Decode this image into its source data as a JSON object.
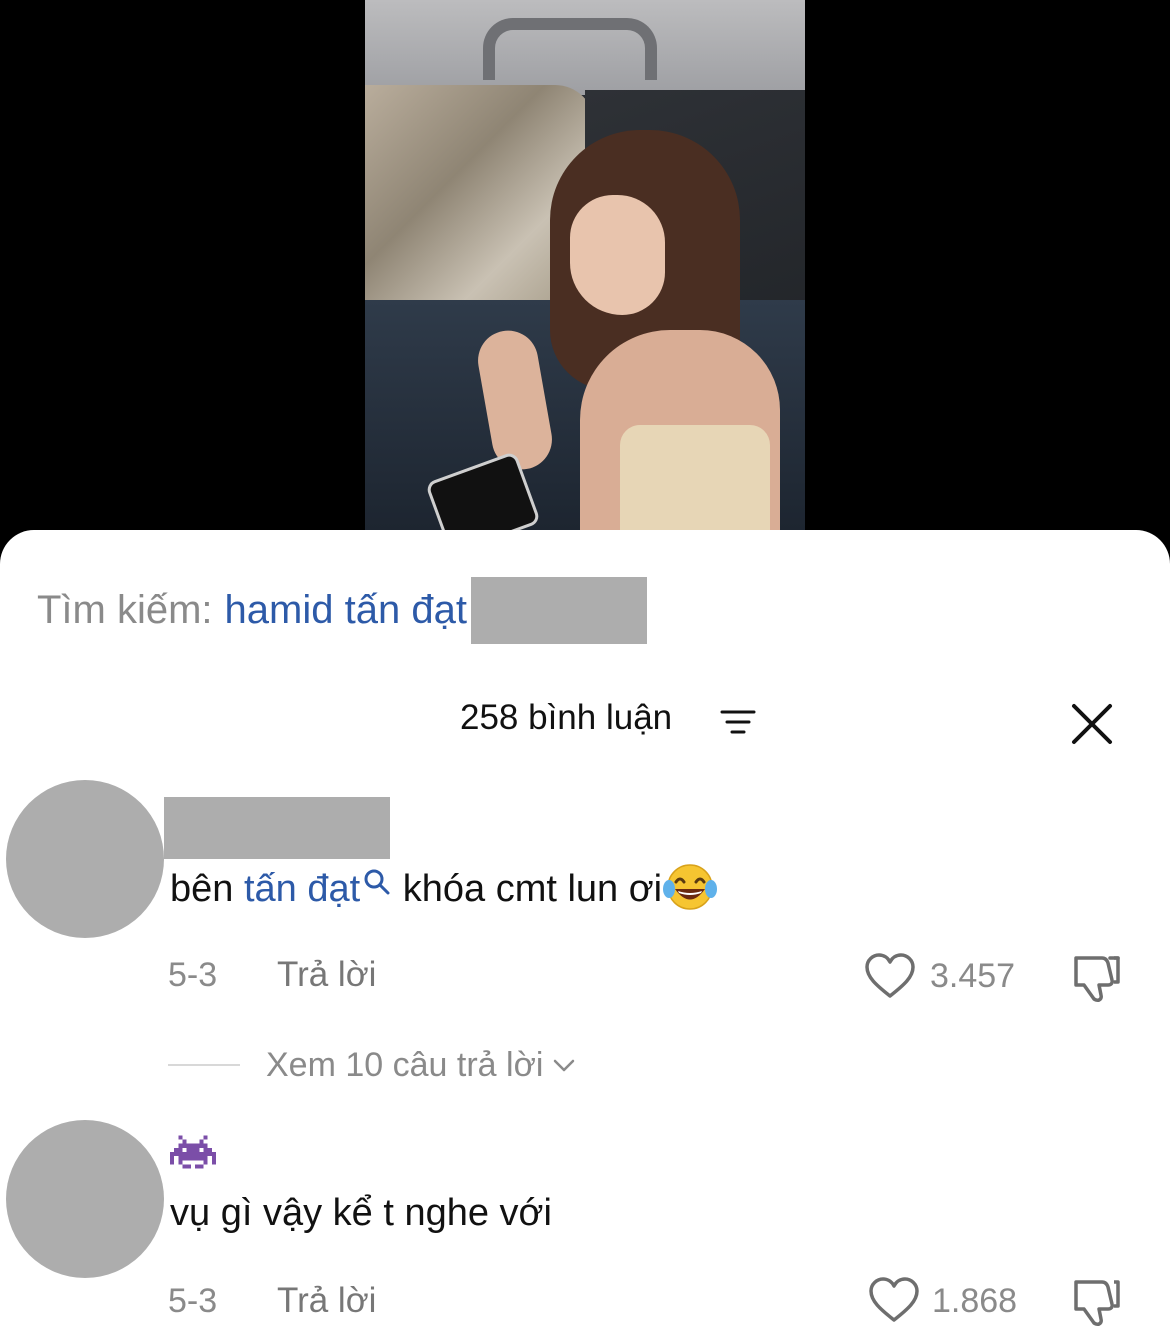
{
  "search": {
    "label": "Tìm kiếm:",
    "query": "hamid tấn đạt"
  },
  "header": {
    "title": "258 bình luận"
  },
  "comments": [
    {
      "text_before": "bên ",
      "mention": "tấn đạt",
      "text_after": " khóa cmt lun ơi",
      "date": "5-3",
      "reply_label": "Trả lời",
      "likes": "3.457",
      "view_replies": "Xem 10 câu trả lời"
    },
    {
      "text": "vụ gì vậy kể t nghe với",
      "date": "5-3",
      "reply_label": "Trả lời",
      "likes": "1.868"
    }
  ],
  "icons": {
    "filter": "filter-lines-icon",
    "close": "close-icon",
    "heart": "heart-outline-icon",
    "dislike": "thumbs-down-outline-icon",
    "mention_search": "search-icon",
    "laugh": "face-with-tears-of-joy-emoji",
    "alien": "alien-monster-emoji",
    "chevron": "chevron-down-icon"
  },
  "colors": {
    "link": "#2d5aa8",
    "muted": "#8a8a8a",
    "redaction": "#adadad"
  }
}
